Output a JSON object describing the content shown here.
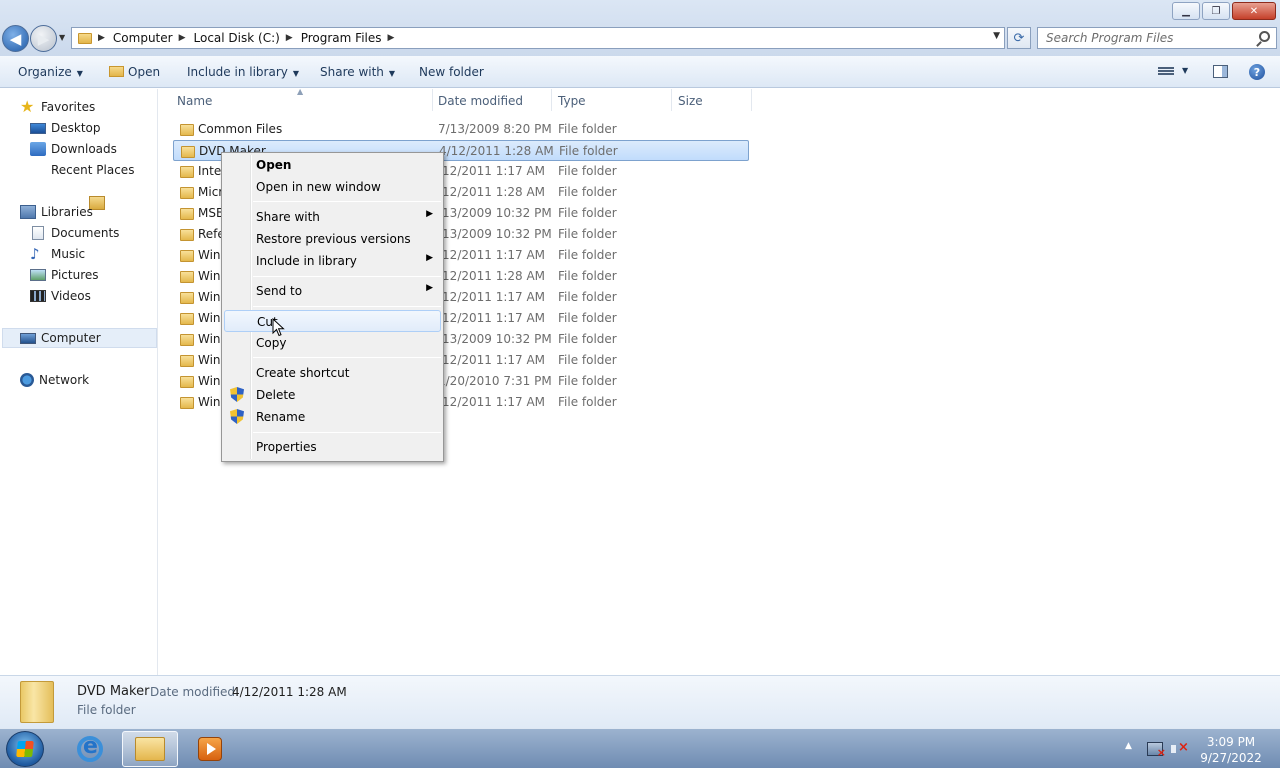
{
  "window": {
    "minimize_glyph": "▁",
    "maximize_glyph": "❐",
    "close_glyph": "✕"
  },
  "address_bar": {
    "breadcrumbs": [
      "Computer",
      "Local Disk (C:)",
      "Program Files"
    ],
    "search_placeholder": "Search Program Files"
  },
  "command_bar": {
    "organize": "Organize",
    "open": "Open",
    "include_in_library": "Include in library",
    "share_with": "Share with",
    "new_folder": "New folder"
  },
  "nav_pane": {
    "favorites": "Favorites",
    "favorites_items": [
      "Desktop",
      "Downloads",
      "Recent Places"
    ],
    "libraries": "Libraries",
    "libraries_items": [
      "Documents",
      "Music",
      "Pictures",
      "Videos"
    ],
    "computer": "Computer",
    "network": "Network"
  },
  "file_list": {
    "columns": [
      "Name",
      "Date modified",
      "Type",
      "Size"
    ],
    "rows": [
      {
        "name": "Common Files",
        "date": "7/13/2009 8:20 PM",
        "type": "File folder"
      },
      {
        "name": "DVD Maker",
        "date": "4/12/2011 1:28 AM",
        "type": "File folder"
      },
      {
        "name": "Inter",
        "date": "/12/2011 1:17 AM",
        "type": "File folder"
      },
      {
        "name": "Micr",
        "date": "/12/2011 1:28 AM",
        "type": "File folder"
      },
      {
        "name": "MSB",
        "date": "/13/2009 10:32 PM",
        "type": "File folder"
      },
      {
        "name": "Refe",
        "date": "/13/2009 10:32 PM",
        "type": "File folder"
      },
      {
        "name": "Wind",
        "date": "/12/2011 1:17 AM",
        "type": "File folder"
      },
      {
        "name": "Wind",
        "date": "/12/2011 1:28 AM",
        "type": "File folder"
      },
      {
        "name": "Wind",
        "date": "/12/2011 1:17 AM",
        "type": "File folder"
      },
      {
        "name": "Wind",
        "date": "/12/2011 1:17 AM",
        "type": "File folder"
      },
      {
        "name": "Wind",
        "date": "/13/2009 10:32 PM",
        "type": "File folder"
      },
      {
        "name": "Wind",
        "date": "/12/2011 1:17 AM",
        "type": "File folder"
      },
      {
        "name": "Wind",
        "date": "1/20/2010 7:31 PM",
        "type": "File folder"
      },
      {
        "name": "Wind",
        "date": "/12/2011 1:17 AM",
        "type": "File folder"
      }
    ]
  },
  "context_menu": {
    "open": "Open",
    "open_new_window": "Open in new window",
    "share_with": "Share with",
    "restore_previous": "Restore previous versions",
    "include_in_library": "Include in library",
    "send_to": "Send to",
    "cut": "Cut",
    "copy": "Copy",
    "create_shortcut": "Create shortcut",
    "delete": "Delete",
    "rename": "Rename",
    "properties": "Properties"
  },
  "details_pane": {
    "name": "DVD Maker",
    "date_modified_label": "Date modified:",
    "date_modified_value": "4/12/2011 1:28 AM",
    "type": "File folder"
  },
  "taskbar": {
    "time": "3:09 PM",
    "date": "9/27/2022"
  }
}
